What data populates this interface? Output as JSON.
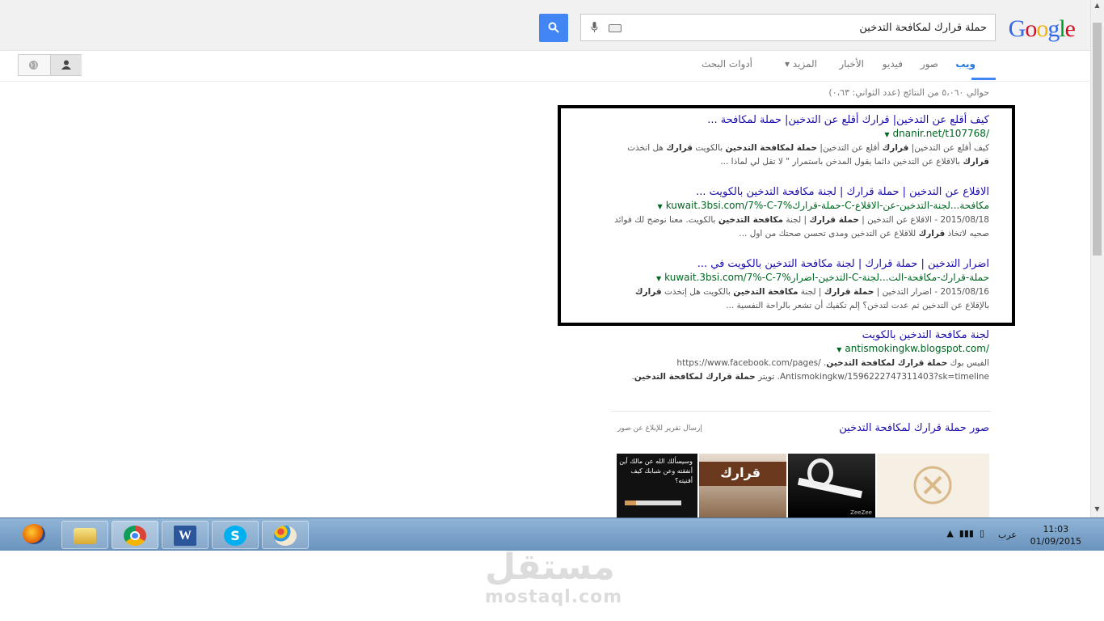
{
  "header": {
    "logo": "Google",
    "query": "حملة قرارك لمكافحة التدخين"
  },
  "tabs": [
    {
      "label": "ويب",
      "active": true
    },
    {
      "label": "صور"
    },
    {
      "label": "فيديو"
    },
    {
      "label": "الأخبار"
    },
    {
      "label": "المزيد ▾"
    },
    {
      "label": "أدوات البحث"
    }
  ],
  "stats": "حوالي ٥،٠٦٠ من النتائج (عدد الثواني: ٠،٦٣)",
  "results": [
    {
      "title": "كيف أقلع عن التدخين| قرارك أقلع عن التدخين| حملة لمكافحة ...",
      "url": "dnanir.net/t107768/",
      "snippet_html": "كيف أقلع عن التدخين| <b>قرارك</b> أقلع عن التدخين| <b>حملة لمكافحة التدخين</b> بالكويت <b>قرارك</b> هل اتخذت <b>قرارك</b> بالاقلاع عن التدخين دائما يقول المدخن باستمرار \" لا تقل لي لماذا ..."
    },
    {
      "title": "الاقلاع عن التدخين | حملة قرارك | لجنة مكافحة التدخين بالكويت ...",
      "url": "kuwait.3bsi.com/7%-C-7%حملة-قرارك-C-مكافحة...لجنة-التدخين-عن-الاقلاع",
      "snippet_html": "2015/08/18 - الاقلاع عن التدخين | <b>حملة قرارك</b> | لجنة <b>مكافحة التدخين</b> بالكويت. معنا نوضح لك فوائد صحيه لاتخاذ <b>قرارك</b> للاقلاع عن التدخين ومدى تحسن صحتك من اول ..."
    },
    {
      "title": "اضرار التدخين | حملة قرارك | لجنة مكافحة التدخين بالكويت في ...",
      "url": "kuwait.3bsi.com/7%-C-7%التدخين-اضرار-C-حملة-قرارك-مكافحة-الت...لجنة",
      "snippet_html": "2015/08/16 - اضرار التدخين | <b>حملة قرارك</b> | لجنة <b>مكافحة التدخين</b> بالكويت هل إتخذت <b>قرارك</b> بالإقلاع عن التدخين ثم عدت لتدخن؟ إلم تكفيك أن تشعر بالراحة النفسية ..."
    },
    {
      "title": "لجنة مكافحة التدخين بالكويت",
      "url": "antismokingkw.blogspot.com/",
      "snippet_html": "الفيس بوك <b>حملة قرارك لمكافحة التدخين</b>. /https://www.facebook.com/pages Antismokingkw/1596222747311403?sk=timeline. تويتر <b>حملة قرارك لمكافحة التدخين</b>."
    }
  ],
  "images": {
    "heading": "صور حملة قرارك لمكافحة التدخين",
    "report": "إرسال تقرير للإبلاغ عن صور",
    "thumbs": [
      {
        "caption": ""
      },
      {
        "caption": "ZeeZee"
      },
      {
        "caption": "قرارك"
      },
      {
        "caption": "وسيسألك الله عن مالك أين أنفقته وعن شبابك كيف أفنيته؟"
      }
    ]
  },
  "taskbar": {
    "apps": [
      "firefox-icon",
      "explorer-icon",
      "chrome-icon",
      "word-icon",
      "skype-icon",
      "paint-icon"
    ],
    "lang": "عرب",
    "time": "11:03",
    "date": "01/09/2015"
  },
  "watermark": {
    "arabic": "مستقل",
    "latin": "mostaql.com"
  },
  "colors": {
    "link": "#1a0dab",
    "url": "#006621",
    "accent": "#4285f4"
  }
}
